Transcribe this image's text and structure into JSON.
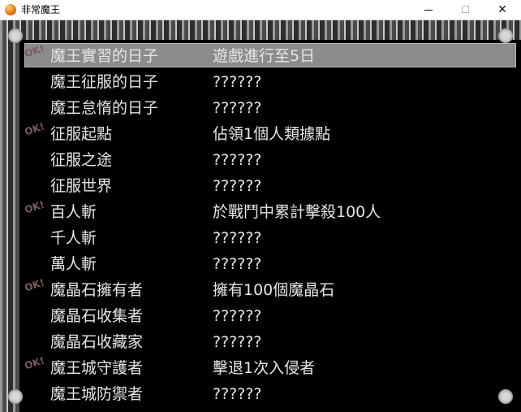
{
  "window": {
    "title": "非常魔王"
  },
  "rows": [
    {
      "ok": "OK!",
      "name": "魔王實習的日子",
      "desc": "遊戲進行至5日",
      "selected": true
    },
    {
      "ok": "",
      "name": "魔王征服的日子",
      "desc": "??????"
    },
    {
      "ok": "",
      "name": "魔王怠惰的日子",
      "desc": "??????"
    },
    {
      "ok": "OK!",
      "name": "征服起點",
      "desc": "佔領1個人類據點"
    },
    {
      "ok": "",
      "name": "征服之途",
      "desc": "??????"
    },
    {
      "ok": "",
      "name": "征服世界",
      "desc": "??????"
    },
    {
      "ok": "OK!",
      "name": "百人斬",
      "desc": "於戰鬥中累計擊殺100人"
    },
    {
      "ok": "",
      "name": "千人斬",
      "desc": "??????"
    },
    {
      "ok": "",
      "name": "萬人斬",
      "desc": "??????"
    },
    {
      "ok": "OK!",
      "name": "魔晶石擁有者",
      "desc": "擁有100個魔晶石"
    },
    {
      "ok": "",
      "name": "魔晶石收集者",
      "desc": "??????"
    },
    {
      "ok": "",
      "name": "魔晶石收藏家",
      "desc": "??????"
    },
    {
      "ok": "OK!",
      "name": "魔王城守護者",
      "desc": "擊退1次入侵者"
    },
    {
      "ok": "",
      "name": "魔王城防禦者",
      "desc": "??????"
    }
  ]
}
